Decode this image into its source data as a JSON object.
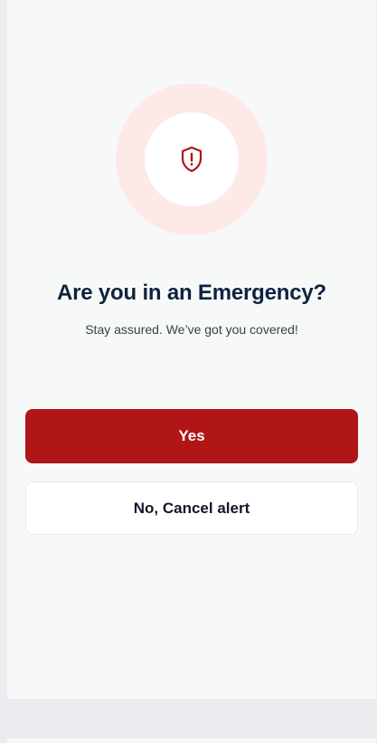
{
  "alert": {
    "icon": "shield-alert-icon",
    "accent_color": "#b01517",
    "ring_color": "#fde9e8"
  },
  "title": "Are you in an Emergency?",
  "subtitle": "Stay assured. We’ve got you covered!",
  "actions": {
    "yes_label": "Yes",
    "cancel_label": "No, Cancel alert"
  }
}
